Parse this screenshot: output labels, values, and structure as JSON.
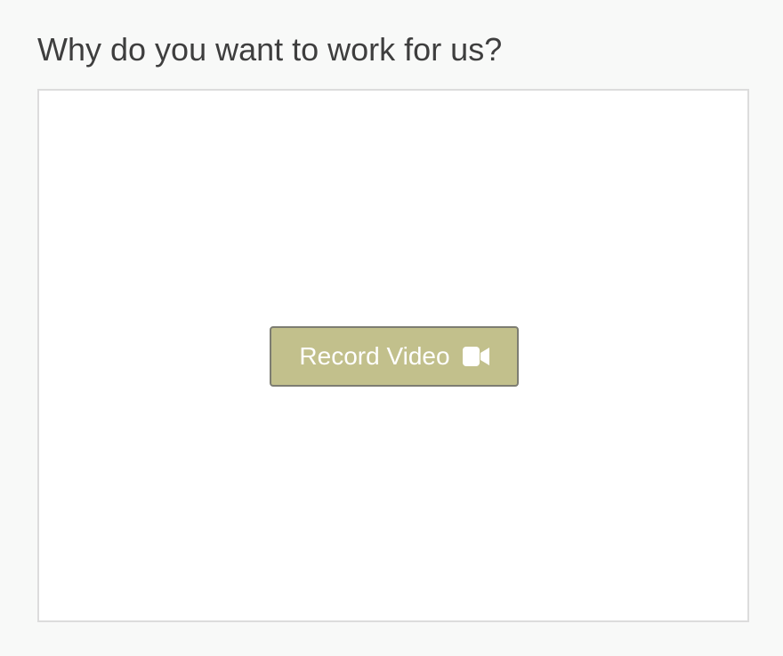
{
  "question": {
    "text": "Why do you want to work for us?"
  },
  "recorder": {
    "button_label": "Record Video",
    "button_icon": "video-camera-icon",
    "button_color": "#c2c08c",
    "button_text_color": "#ffffff"
  }
}
